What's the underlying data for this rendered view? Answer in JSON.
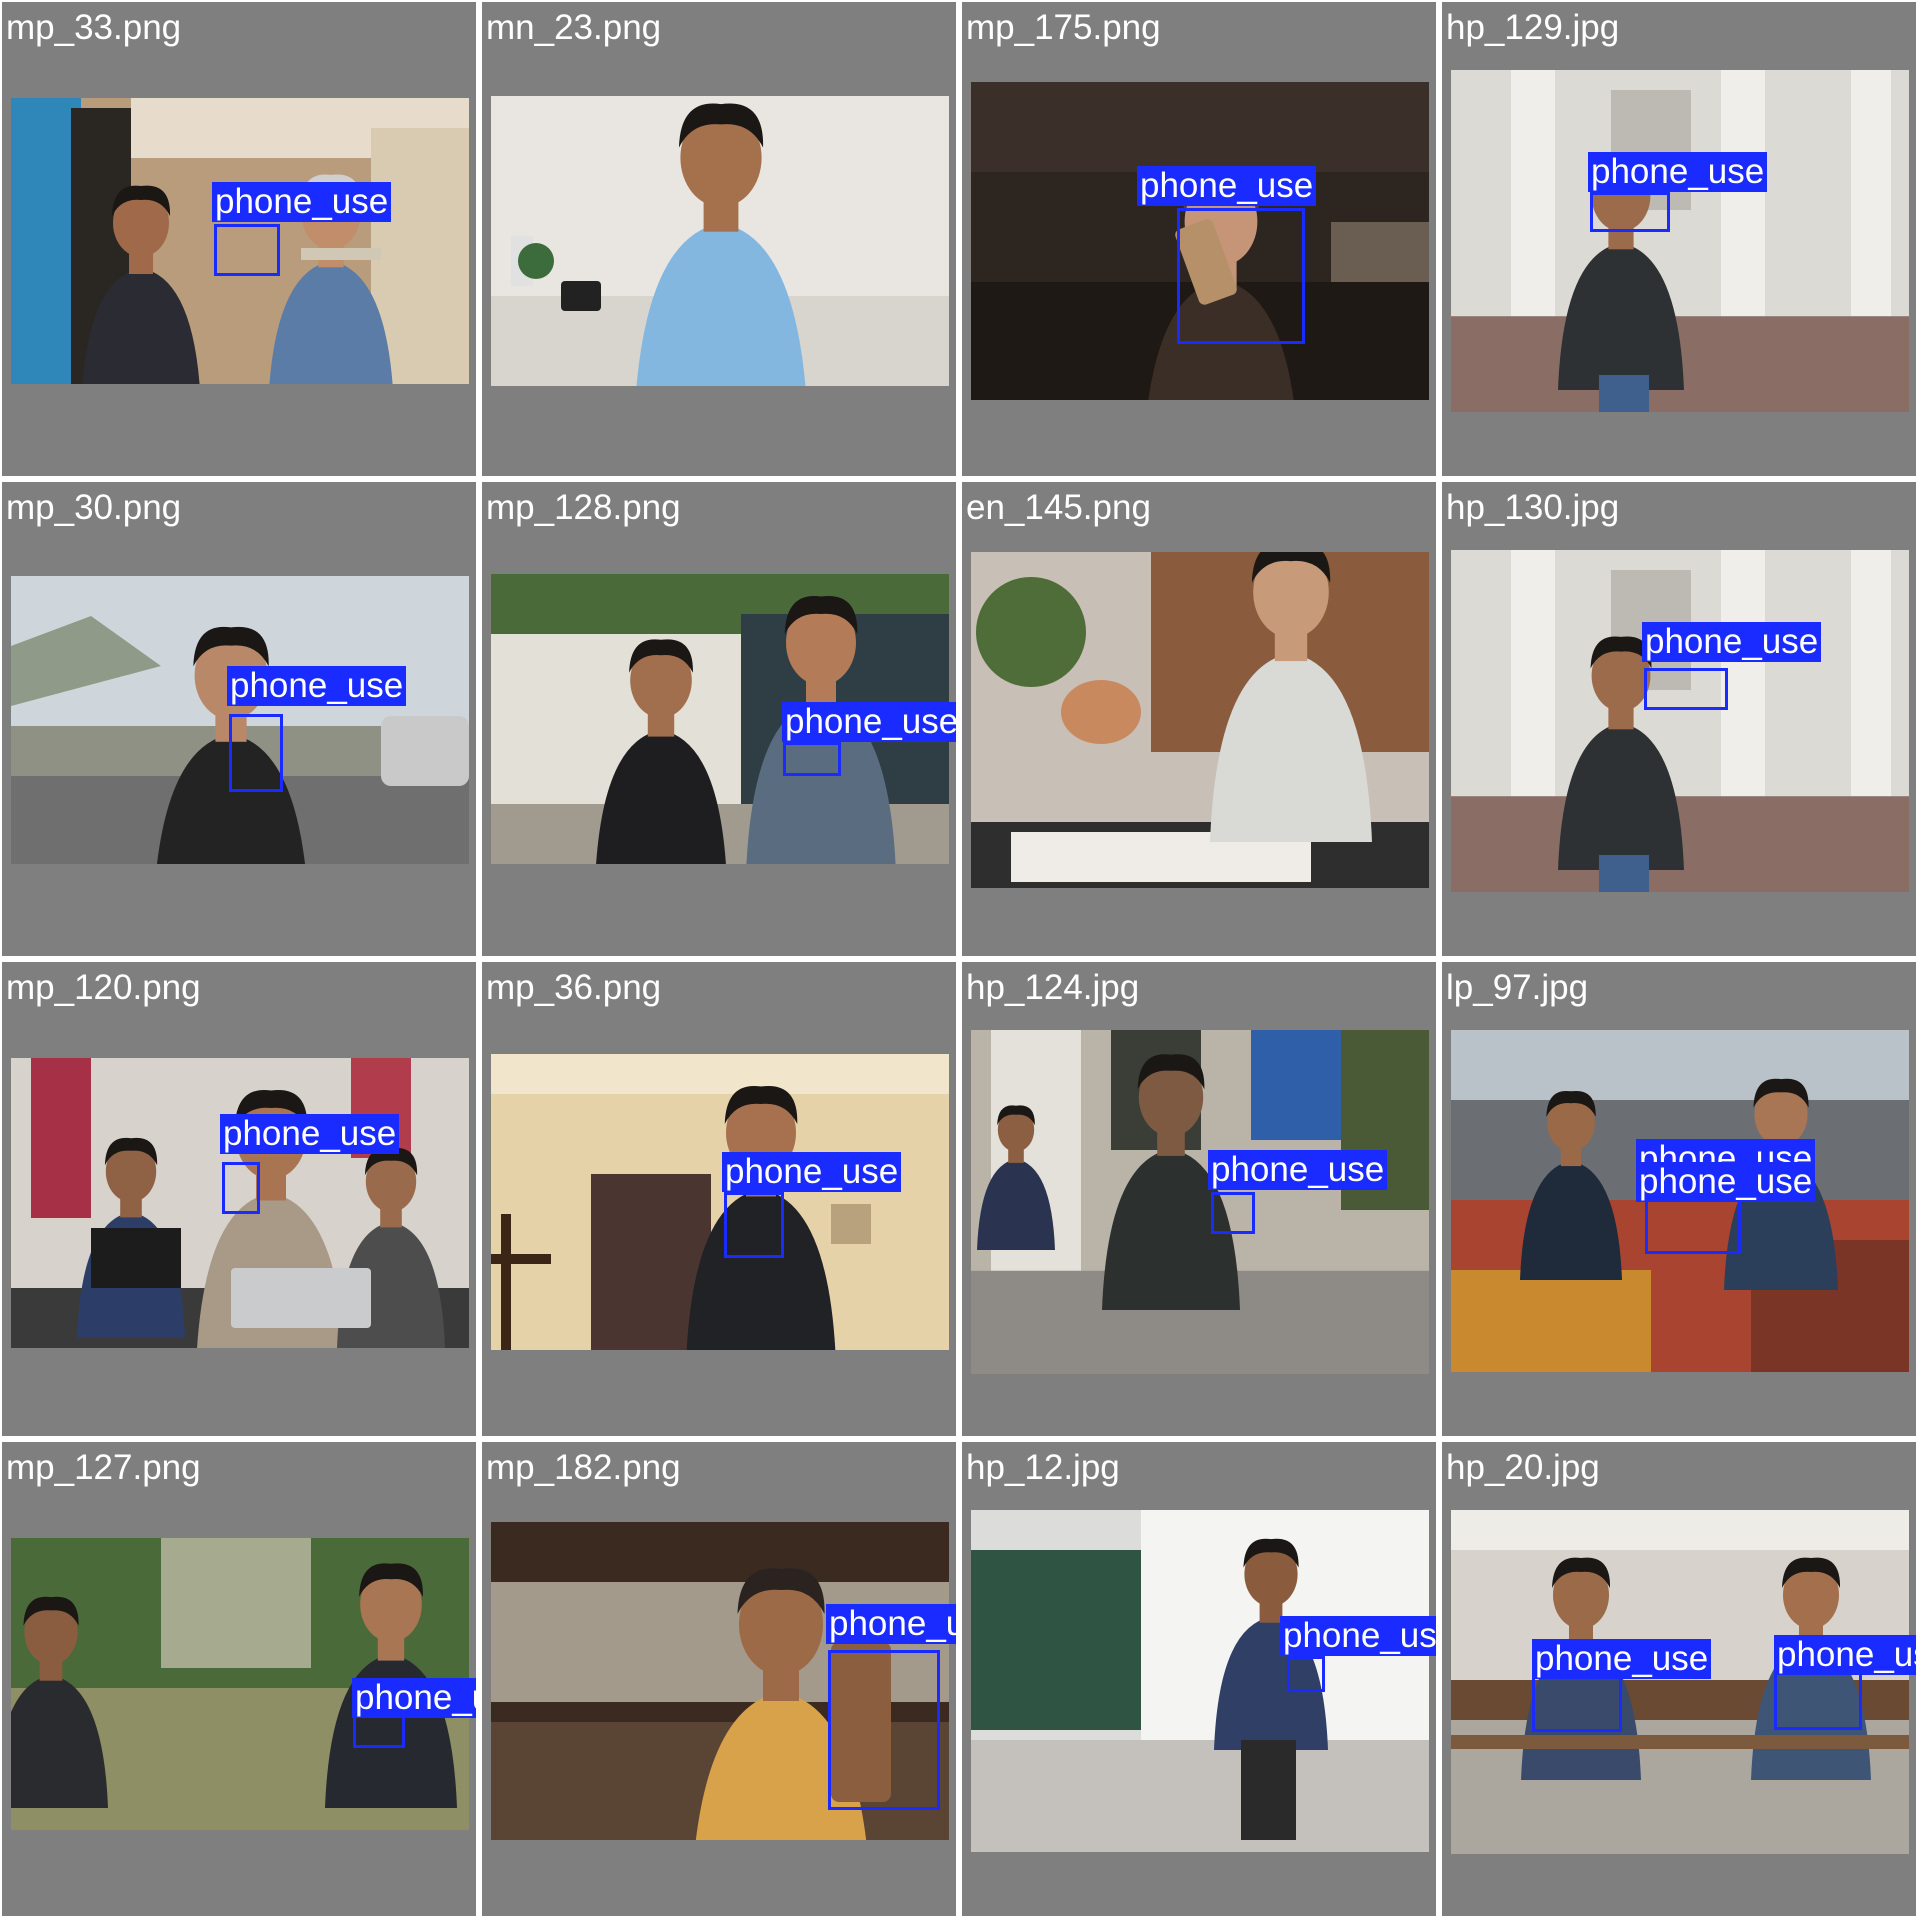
{
  "grid": {
    "detection_label": "phone_use",
    "colors": {
      "background": "#7f7f7f",
      "title_text": "#ffffff",
      "box": "#1a2bff",
      "label_text": "#ffffff"
    },
    "tiles": [
      {
        "title": "mp_33.png",
        "scene": "indoor-two-men-shop",
        "detections": 1
      },
      {
        "title": "mn_23.png",
        "scene": "man-blue-tshirt-studio",
        "detections": 0
      },
      {
        "title": "mp_175.png",
        "scene": "woman-phone-office-dark",
        "detections": 1
      },
      {
        "title": "hp_129.jpg",
        "scene": "man-columns-building",
        "detections": 1
      },
      {
        "title": "mp_30.png",
        "scene": "man-roadside-phone-call",
        "detections": 1
      },
      {
        "title": "mp_128.png",
        "scene": "two-men-outdoor-gate",
        "detections": 1
      },
      {
        "title": "en_145.png",
        "scene": "man-writing-desk",
        "detections": 0
      },
      {
        "title": "hp_130.jpg",
        "scene": "man-columns-building",
        "detections": 1
      },
      {
        "title": "mp_120.png",
        "scene": "office-man-laptop-call",
        "detections": 1
      },
      {
        "title": "mp_36.png",
        "scene": "man-hallway-phone",
        "detections": 1
      },
      {
        "title": "hp_124.jpg",
        "scene": "men-campus-building",
        "detections": 1
      },
      {
        "title": "lp_97.jpg",
        "scene": "people-in-bed-phones",
        "detections": 2
      },
      {
        "title": "mp_127.png",
        "scene": "men-garden-phone",
        "detections": 1
      },
      {
        "title": "mp_182.png",
        "scene": "man-car-phone-call",
        "detections": 1
      },
      {
        "title": "hp_12.jpg",
        "scene": "man-classroom-blackboard",
        "detections": 1
      },
      {
        "title": "hp_20.jpg",
        "scene": "two-men-classroom-bench",
        "detections": 2
      }
    ]
  }
}
